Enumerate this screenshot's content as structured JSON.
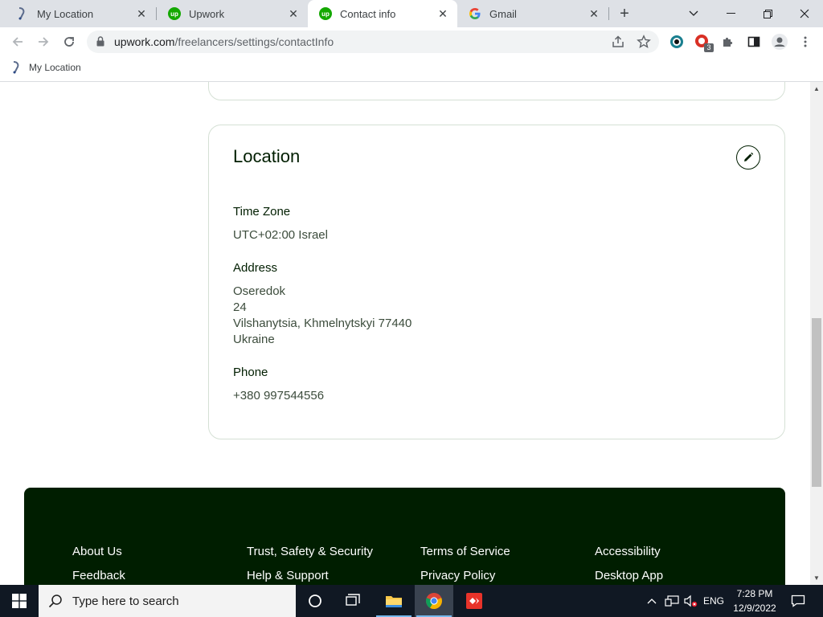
{
  "tabs": [
    {
      "title": "My Location",
      "favicon": "location-pin-icon"
    },
    {
      "title": "Upwork",
      "favicon": "upwork-icon"
    },
    {
      "title": "Contact info",
      "favicon": "upwork-icon"
    },
    {
      "title": "Gmail",
      "favicon": "google-icon"
    }
  ],
  "upwork_favicon_text": "up",
  "address_bar": {
    "url_domain": "upwork.com",
    "url_path": "/freelancers/settings/contactInfo"
  },
  "bookmarks": [
    {
      "label": "My Location"
    }
  ],
  "extension_badge": "3",
  "location": {
    "title": "Location",
    "time_zone_label": "Time Zone",
    "time_zone_value": "UTC+02:00 Israel",
    "address_label": "Address",
    "address_lines": [
      "Oseredok",
      "24",
      "Vilshanytsia, Khmelnytskyi 77440",
      "Ukraine"
    ],
    "phone_label": "Phone",
    "phone_value": "+380 997544556"
  },
  "footer": {
    "links": [
      "About Us",
      "Trust, Safety & Security",
      "Terms of Service",
      "Accessibility",
      "Feedback",
      "Help & Support",
      "Privacy Policy",
      "Desktop App"
    ]
  },
  "taskbar": {
    "search_placeholder": "Type here to search",
    "language": "ENG",
    "time": "7:28 PM",
    "date": "12/9/2022"
  },
  "colors": {
    "upwork_green": "#14a800",
    "footer_bg": "#001e00",
    "taskbar_bg": "#101823"
  }
}
